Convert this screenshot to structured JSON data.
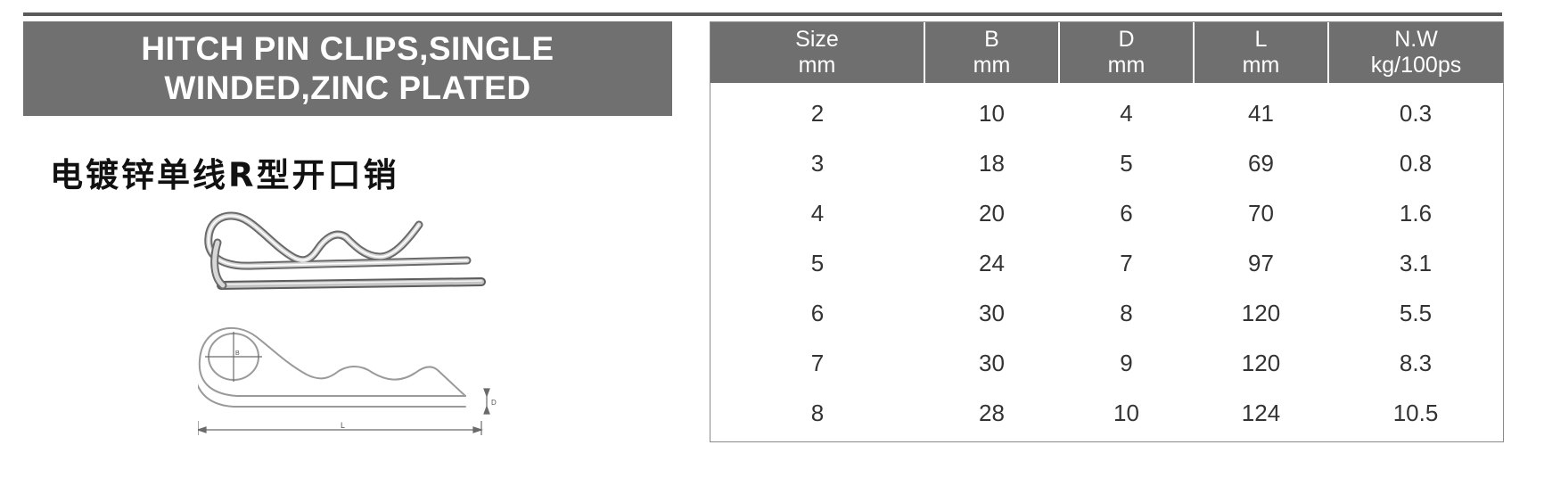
{
  "product": {
    "title_lines": [
      "HITCH PIN CLIPS,SINGLE",
      "WINDED,ZINC PLATED"
    ],
    "chinese_name": "电镀锌单线R型开口销"
  },
  "drawing_labels": {
    "length": "L",
    "diameter": "D",
    "bend": "B"
  },
  "table": {
    "headers": [
      {
        "name": "Size",
        "unit": "mm"
      },
      {
        "name": "B",
        "unit": "mm"
      },
      {
        "name": "D",
        "unit": "mm"
      },
      {
        "name": "L",
        "unit": "mm"
      },
      {
        "name": "N.W",
        "unit": "kg/100ps"
      }
    ],
    "rows": [
      [
        "2",
        "10",
        "4",
        "41",
        "0.3"
      ],
      [
        "3",
        "18",
        "5",
        "69",
        "0.8"
      ],
      [
        "4",
        "20",
        "6",
        "70",
        "1.6"
      ],
      [
        "5",
        "24",
        "7",
        "97",
        "3.1"
      ],
      [
        "6",
        "30",
        "8",
        "120",
        "5.5"
      ],
      [
        "7",
        "30",
        "9",
        "120",
        "8.3"
      ],
      [
        "8",
        "28",
        "10",
        "124",
        "10.5"
      ]
    ]
  },
  "colors": {
    "header_bg": "#707070",
    "rule": "#5a5a5a",
    "text": "#333333"
  }
}
